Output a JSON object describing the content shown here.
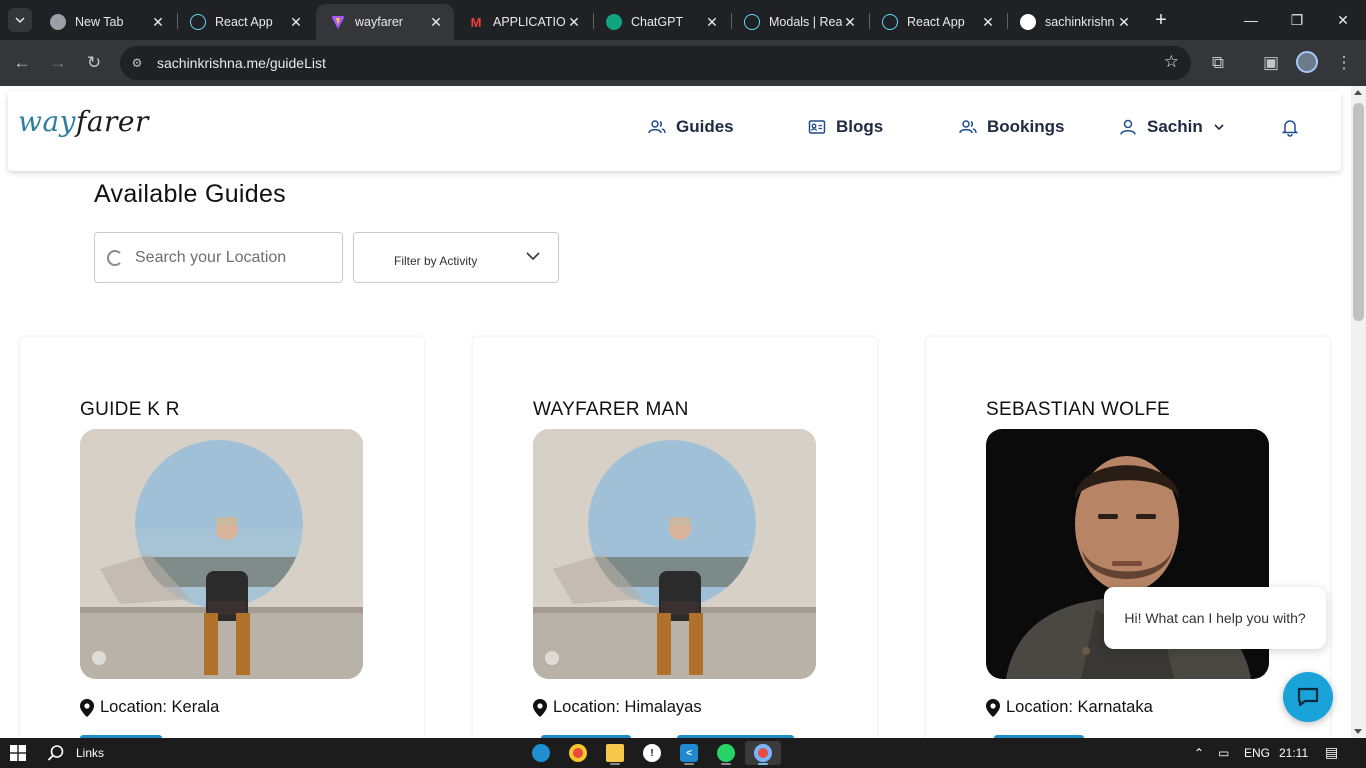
{
  "browser": {
    "tabs": [
      {
        "title": "New Tab",
        "icon": "chrome-icon",
        "color": "#9aa0a6"
      },
      {
        "title": "React App",
        "icon": "react-icon",
        "color": "#61dafb"
      },
      {
        "title": "wayfarer",
        "icon": "vite-icon",
        "color": "#a259ff",
        "active": true
      },
      {
        "title": "APPLICATION",
        "icon": "gmail-icon",
        "color": "#ea4335"
      },
      {
        "title": "ChatGPT",
        "icon": "chatgpt-icon",
        "color": "#10a37f"
      },
      {
        "title": "Modals | Rea",
        "icon": "reactstrap-icon",
        "color": "#61dafb"
      },
      {
        "title": "React App",
        "icon": "react-icon",
        "color": "#61dafb"
      },
      {
        "title": "sachinkrishn",
        "icon": "github-icon",
        "color": "#ffffff"
      }
    ],
    "url": "sachinkrishna.me/guideList"
  },
  "site": {
    "logo_way": "way",
    "logo_farer": "farer",
    "nav": {
      "guides": "Guides",
      "blogs": "Blogs",
      "bookings": "Bookings",
      "user": "Sachin"
    },
    "page_title": "Available Guides",
    "search_placeholder": "Search your Location",
    "filter_label": "Filter by Activity",
    "cards": [
      {
        "name": "GUIDE K R",
        "location": "Location: Kerala",
        "photo": "man-in-circle-window"
      },
      {
        "name": "WAYFARER MAN",
        "location": "Location: Himalayas",
        "photo": "man-in-circle-window"
      },
      {
        "name": "SEBASTIAN WOLFE",
        "location": "Location: Karnataka",
        "photo": "bearded-man-portrait"
      }
    ],
    "chat_text": "Hi! What can I help you with?"
  },
  "taskbar": {
    "links_label": "Links",
    "lang": "ENG",
    "time": "21:11"
  },
  "colors": {
    "accent": "#1aa3d9",
    "nav_icon": "#1f4e8c",
    "logo_way": "#2e7ea0"
  }
}
